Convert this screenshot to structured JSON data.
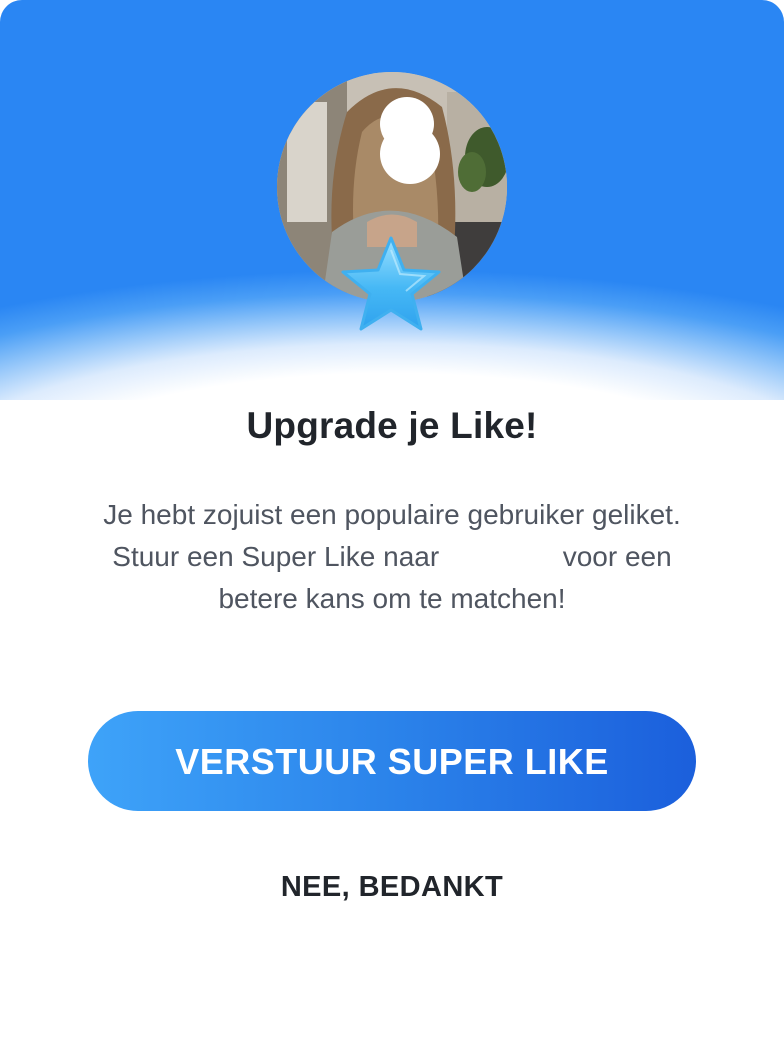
{
  "dialog": {
    "title": "Upgrade je Like!",
    "message_line1": "Je hebt zojuist een populaire gebruiker geliket.",
    "message_line2_prefix": "Stuur een Super Like naar",
    "message_line2_suffix": "voor een betere kans om te matchen!",
    "primary_button_label": "VERSTUUR SUPER LIKE",
    "secondary_button_label": "NEE, BEDANKT"
  },
  "icons": {
    "badge": "star-icon"
  },
  "colors": {
    "header_blue": "#2a86f3",
    "button_gradient_start": "#3ea3f9",
    "button_gradient_end": "#1b5fdc",
    "star": "#4fc3f7",
    "title_text": "#21252b",
    "body_text": "#4f5560"
  }
}
